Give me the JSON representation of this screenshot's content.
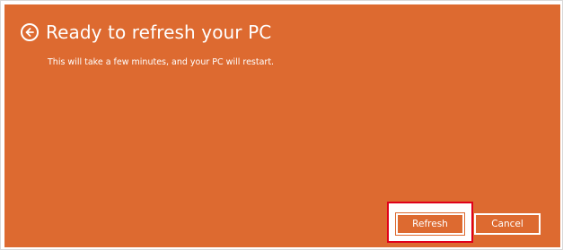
{
  "header": {
    "back_icon": "back-arrow-circle-icon",
    "title": "Ready to refresh your PC"
  },
  "body": {
    "subtitle": "This will take a few minutes, and your PC will restart."
  },
  "buttons": {
    "refresh_label": "Refresh",
    "cancel_label": "Cancel"
  },
  "colors": {
    "background": "#dd6a30",
    "text": "#ffffff",
    "highlight": "#e0001a"
  }
}
